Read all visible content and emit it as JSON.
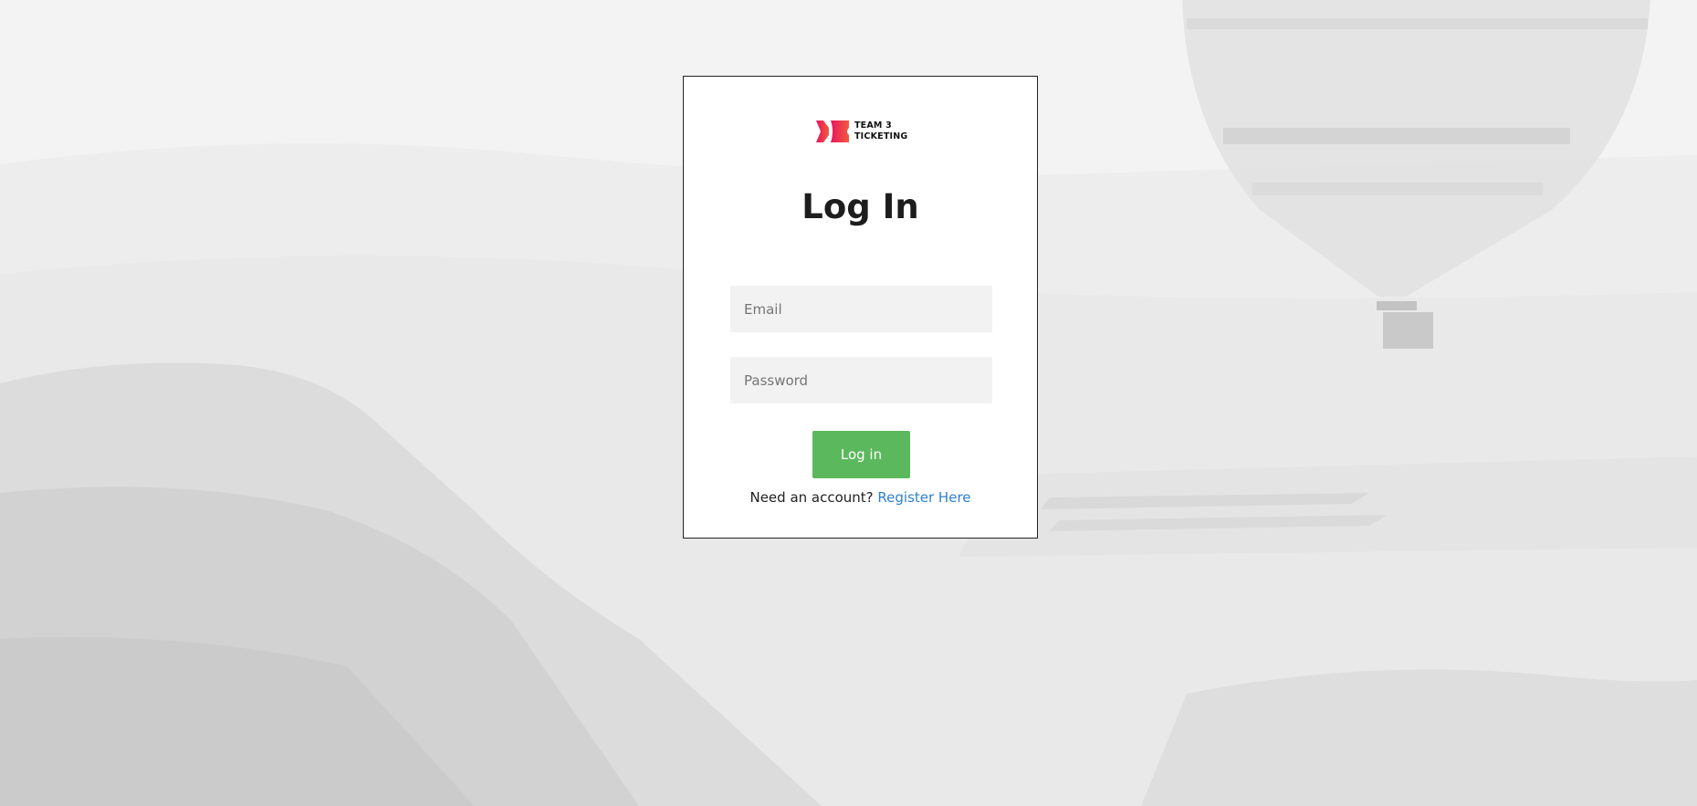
{
  "brand": {
    "logo_line1": "TEAM 3",
    "logo_line2": "TICKETING",
    "logo_colors": [
      "#e8155f",
      "#f25a3c"
    ]
  },
  "form": {
    "title": "Log In",
    "email_placeholder": "Email",
    "password_placeholder": "Password",
    "submit_label": "Log in",
    "submit_color": "#5cb85c"
  },
  "register": {
    "prompt": "Need an account?",
    "link_label": "Register Here",
    "link_color": "#2f7fd1"
  },
  "background": {
    "description_icon": "hot-air-balloon-landscape"
  }
}
